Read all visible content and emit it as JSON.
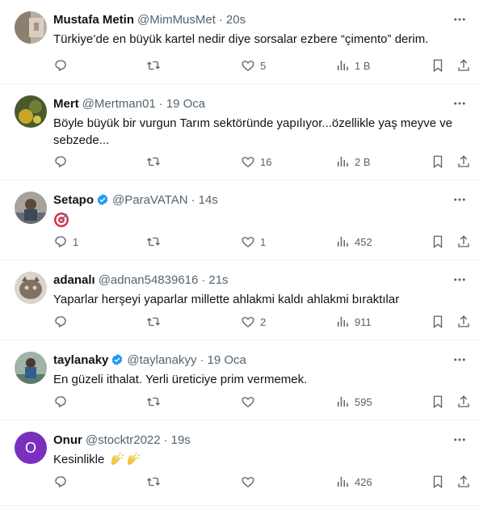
{
  "tweets": [
    {
      "name": "Mustafa Metin",
      "handle": "@MimMusMet",
      "time": "20s",
      "verified": false,
      "text": "Türkiye’de en büyük kartel nedir diye sorsalar ezbere “çimento” derim.",
      "replies": "",
      "retweets": "",
      "likes": "5",
      "views": "1 B"
    },
    {
      "name": "Mert",
      "handle": "@Mertman01",
      "time": "19 Oca",
      "verified": false,
      "text": "Böyle büyük bir vurgun Tarım sektöründe yapılıyor...özellikle yaş meyve ve sebzede...",
      "replies": "",
      "retweets": "",
      "likes": "16",
      "views": "2 B"
    },
    {
      "name": "Setapo",
      "handle": "@ParaVATAN",
      "time": "14s",
      "verified": true,
      "text": "",
      "emoji": "target-emoji",
      "replies": "1",
      "retweets": "",
      "likes": "1",
      "views": "452"
    },
    {
      "name": "adanalı",
      "handle": "@adnan54839616",
      "time": "21s",
      "verified": false,
      "text": "Yaparlar herşeyi yaparlar millette ahlakmi kaldı ahlakmi bıraktılar",
      "replies": "",
      "retweets": "",
      "likes": "2",
      "views": "911"
    },
    {
      "name": "taylanaky",
      "handle": "@taylanakyy",
      "time": "19 Oca",
      "verified": true,
      "text": "En güzeli ithalat. Yerli üreticiye prim vermemek.",
      "replies": "",
      "retweets": "",
      "likes": "",
      "views": "595"
    },
    {
      "name": "Onur",
      "handle": "@stocktr2022",
      "time": "19s",
      "verified": false,
      "avatar_letter": "O",
      "text": "Kesinlikle",
      "emoji": "clapping-hands-emoji",
      "replies": "",
      "retweets": "",
      "likes": "",
      "views": "426"
    }
  ],
  "separator": "·",
  "colors": {
    "verified": "#1d9bf0",
    "muted": "#536471",
    "text": "#0f1419",
    "onur_avatar": "#7b2fbe"
  }
}
